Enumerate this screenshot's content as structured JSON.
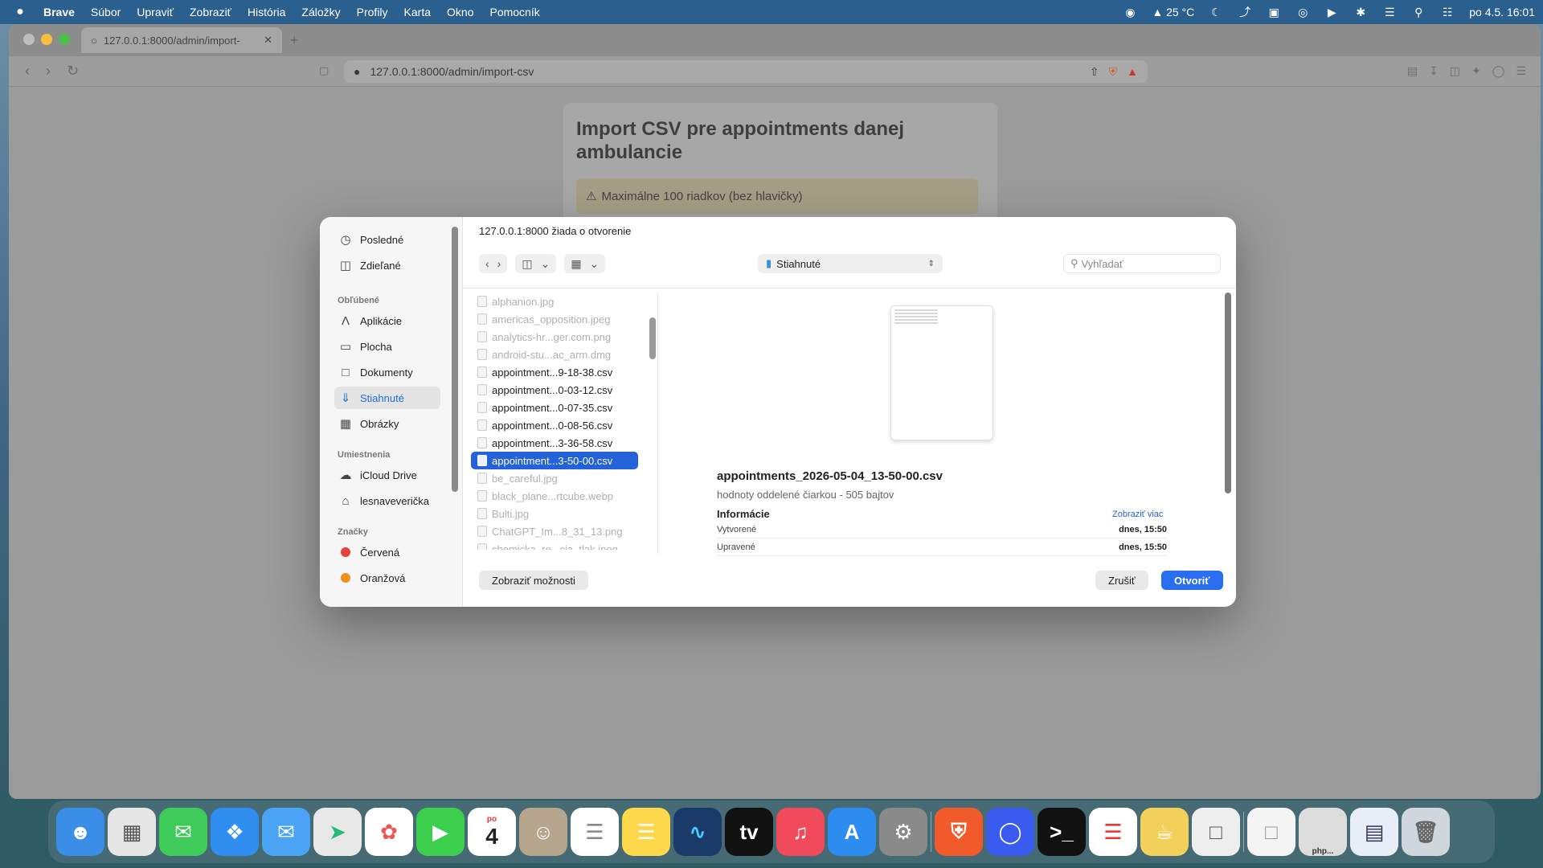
{
  "menubar": {
    "apple": "",
    "app": "Brave",
    "items": [
      "Súbor",
      "Upraviť",
      "Zobraziť",
      "História",
      "Záložky",
      "Profily",
      "Karta",
      "Okno",
      "Pomocník"
    ],
    "temperature": "25 °C",
    "datetime": "po 4.5.  16:01"
  },
  "browser": {
    "tab_title": "127.0.0.1:8000/admin/import-",
    "url": "127.0.0.1:8000/admin/import-csv"
  },
  "page": {
    "title": "Import CSV pre appointments danej ambulancie",
    "warning": "Maximálne 100 riadkov (bez hlavičky)"
  },
  "dialog": {
    "title": "127.0.0.1:8000 žiada o otvorenie",
    "location": "Stiahnuté",
    "search_placeholder": "Vyhľadať",
    "sidebar": {
      "top": [
        {
          "label": "Posledné",
          "icon": "clock-icon"
        },
        {
          "label": "Zdieľané",
          "icon": "shared-folder-icon"
        }
      ],
      "favorites_heading": "Obľúbené",
      "favorites": [
        {
          "label": "Aplikácie",
          "icon": "applications-icon"
        },
        {
          "label": "Plocha",
          "icon": "desktop-icon"
        },
        {
          "label": "Dokumenty",
          "icon": "document-icon"
        },
        {
          "label": "Stiahnuté",
          "icon": "download-icon"
        },
        {
          "label": "Obrázky",
          "icon": "photos-icon"
        }
      ],
      "locations_heading": "Umiestnenia",
      "locations": [
        {
          "label": "iCloud Drive",
          "icon": "cloud-icon"
        },
        {
          "label": "lesnaveverička",
          "icon": "home-icon"
        }
      ],
      "tags_heading": "Značky",
      "tags": [
        {
          "label": "Červená",
          "color": "#e8403a"
        },
        {
          "label": "Oranžová",
          "color": "#f0901a"
        }
      ]
    },
    "files": [
      "alphanion.jpg",
      "americas_opposition.jpeg",
      "analytics-hr...ger.com.png",
      "android-stu...ac_arm.dmg",
      "appointment...9-18-38.csv",
      "appointment...0-03-12.csv",
      "appointment...0-07-35.csv",
      "appointment...0-08-56.csv",
      "appointment...3-36-58.csv",
      "appointment...3-50-00.csv",
      "be_careful.jpg",
      "black_plane...rtcube.webp",
      "Bulti.jpg",
      "ChatGPT_Im...8_31_13.png",
      "chemicka_re...cia_tlak.jpeg"
    ],
    "selected_file_index": 9,
    "preview": {
      "name": "appointments_2026-05-04_13-50-00.csv",
      "meta": "hodnoty oddelené čiarkou - 505 bajtov",
      "info_heading": "Informácie",
      "more_link": "Zobraziť viac",
      "rows": [
        {
          "label": "Vytvorené",
          "value": "dnes, 15:50"
        },
        {
          "label": "Upravené",
          "value": "dnes, 15:50"
        }
      ]
    },
    "buttons": {
      "options": "Zobraziť možnosti",
      "cancel": "Zrušiť",
      "open": "Otvoriť"
    }
  },
  "dock": {
    "calendar_day": "po",
    "calendar_date": "4",
    "php_label": "php..."
  }
}
